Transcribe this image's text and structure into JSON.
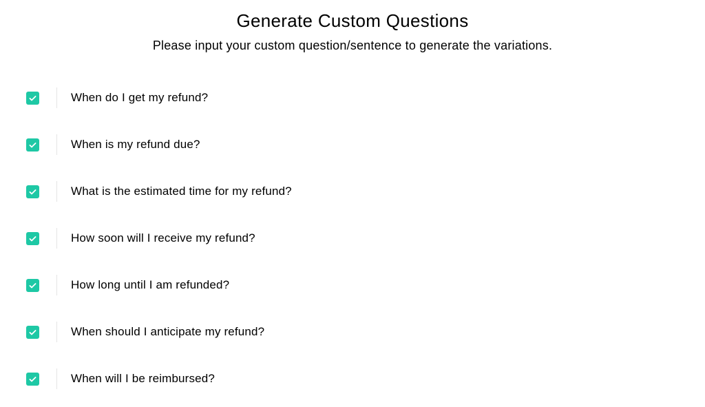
{
  "header": {
    "title": "Generate Custom Questions",
    "subtitle": "Please input your custom question/sentence to generate the variations."
  },
  "questions": [
    {
      "text": "When do I get my refund?",
      "checked": true
    },
    {
      "text": "When is my refund due?",
      "checked": true
    },
    {
      "text": "What is the estimated time for my refund?",
      "checked": true
    },
    {
      "text": "How soon will I receive my refund?",
      "checked": true
    },
    {
      "text": "How long until I am refunded?",
      "checked": true
    },
    {
      "text": "When should I anticipate my refund?",
      "checked": true
    },
    {
      "text": "When will I be reimbursed?",
      "checked": true
    }
  ]
}
